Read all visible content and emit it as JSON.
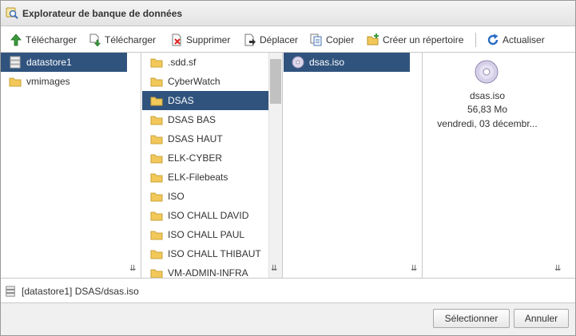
{
  "window": {
    "title": "Explorateur de banque de données"
  },
  "toolbar": {
    "upload_file": "Télécharger",
    "download": "Télécharger",
    "delete": "Supprimer",
    "move": "Déplacer",
    "copy": "Copier",
    "new_folder": "Créer un répertoire",
    "refresh": "Actualiser"
  },
  "datastores": [
    {
      "name": "datastore1",
      "selected": true
    },
    {
      "name": "vmimages",
      "selected": false
    }
  ],
  "folders": [
    {
      "name": ".sdd.sf"
    },
    {
      "name": "CyberWatch"
    },
    {
      "name": "DSAS",
      "selected": true
    },
    {
      "name": "DSAS BAS"
    },
    {
      "name": "DSAS HAUT"
    },
    {
      "name": "ELK-CYBER"
    },
    {
      "name": "ELK-Filebeats"
    },
    {
      "name": "ISO"
    },
    {
      "name": "ISO CHALL DAVID"
    },
    {
      "name": "ISO CHALL PAUL"
    },
    {
      "name": "ISO CHALL THIBAUT"
    },
    {
      "name": "VM-ADMIN-INFRA"
    }
  ],
  "files": [
    {
      "name": "dsas.iso",
      "selected": true
    }
  ],
  "details": {
    "name": "dsas.iso",
    "size": "56,83 Mo",
    "date": "vendredi, 03 décembr..."
  },
  "path": "[datastore1] DSAS/dsas.iso",
  "buttons": {
    "select": "Sélectionner",
    "cancel": "Annuler"
  },
  "colors": {
    "selection": "#30537e",
    "folder": "#f2c85b",
    "refresh": "#2b6cc4",
    "upload": "#3a9a3a"
  }
}
